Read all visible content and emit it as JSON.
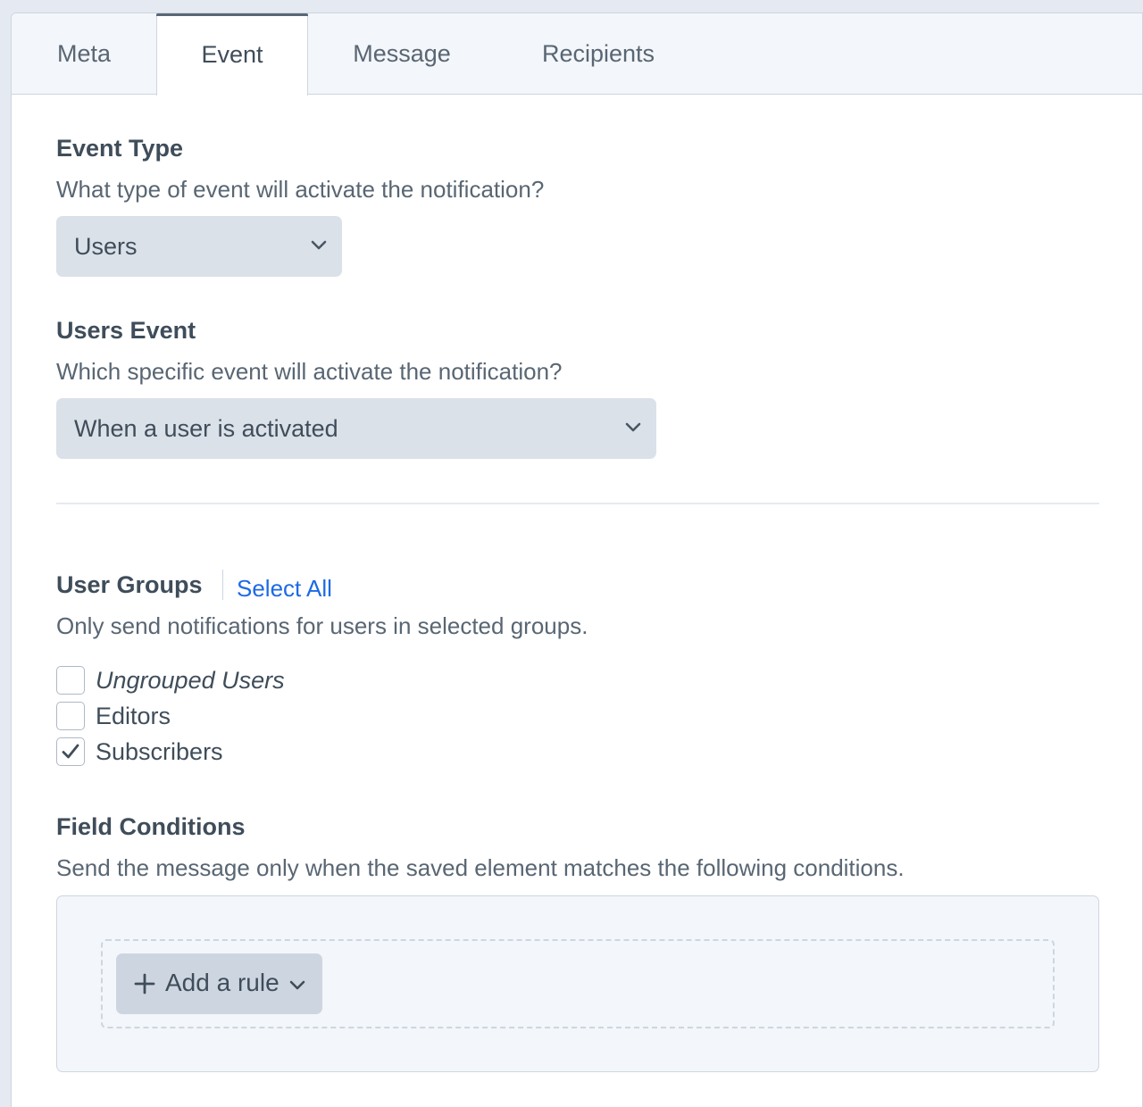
{
  "tabs": [
    {
      "label": "Meta",
      "active": false
    },
    {
      "label": "Event",
      "active": true
    },
    {
      "label": "Message",
      "active": false
    },
    {
      "label": "Recipients",
      "active": false
    }
  ],
  "event_type": {
    "heading": "Event Type",
    "instructions": "What type of event will activate the notification?",
    "selected": "Users"
  },
  "users_event": {
    "heading": "Users Event",
    "instructions": "Which specific event will activate the notification?",
    "selected": "When a user is activated"
  },
  "user_groups": {
    "heading": "User Groups",
    "select_all": "Select All",
    "instructions": "Only send notifications for users in selected groups.",
    "options": [
      {
        "label": "Ungrouped Users",
        "checked": false,
        "italic": true
      },
      {
        "label": "Editors",
        "checked": false,
        "italic": false
      },
      {
        "label": "Subscribers",
        "checked": true,
        "italic": false
      }
    ]
  },
  "field_conditions": {
    "heading": "Field Conditions",
    "instructions": "Send the message only when the saved element matches the following conditions.",
    "add_rule_label": "Add a rule"
  },
  "colors": {
    "link": "#1d6ae5",
    "text": "#3f4d5a",
    "select_bg": "#dbe1e9",
    "background": "#e4e9f2"
  }
}
